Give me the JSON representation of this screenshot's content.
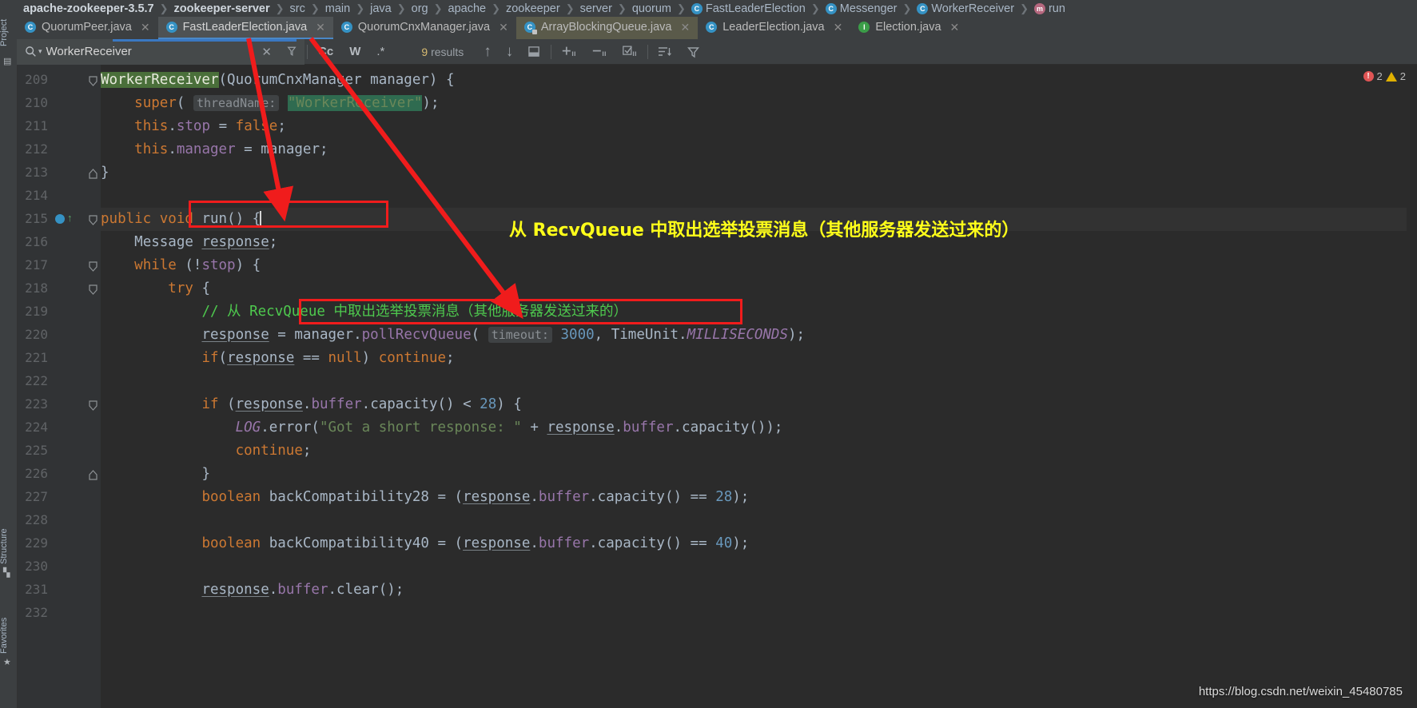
{
  "breadcrumb": [
    {
      "label": "apache-zookeeper-3.5.7",
      "bold": true,
      "squiggle": false,
      "badge": ""
    },
    {
      "label": "zookeeper-server",
      "bold": true,
      "squiggle": false,
      "badge": ""
    },
    {
      "label": "src",
      "bold": false,
      "squiggle": true,
      "badge": ""
    },
    {
      "label": "main",
      "bold": false,
      "squiggle": true,
      "badge": ""
    },
    {
      "label": "java",
      "bold": false,
      "squiggle": true,
      "badge": ""
    },
    {
      "label": "org",
      "bold": false,
      "squiggle": true,
      "badge": ""
    },
    {
      "label": "apache",
      "bold": false,
      "squiggle": true,
      "badge": ""
    },
    {
      "label": "zookeeper",
      "bold": false,
      "squiggle": true,
      "badge": ""
    },
    {
      "label": "server",
      "bold": false,
      "squiggle": true,
      "badge": ""
    },
    {
      "label": "quorum",
      "bold": false,
      "squiggle": false,
      "badge": ""
    },
    {
      "label": "FastLeaderElection",
      "bold": false,
      "squiggle": false,
      "badge": "class"
    },
    {
      "label": "Messenger",
      "bold": false,
      "squiggle": false,
      "badge": "class"
    },
    {
      "label": "WorkerReceiver",
      "bold": false,
      "squiggle": false,
      "badge": "class"
    },
    {
      "label": "run",
      "bold": false,
      "squiggle": false,
      "badge": "method"
    }
  ],
  "tabs": [
    {
      "label": "QuorumPeer.java",
      "badge": "class",
      "active": false,
      "highlight": false,
      "locked": false
    },
    {
      "label": "FastLeaderElection.java",
      "badge": "class",
      "active": true,
      "highlight": false,
      "locked": false
    },
    {
      "label": "QuorumCnxManager.java",
      "badge": "class",
      "active": false,
      "highlight": false,
      "locked": false
    },
    {
      "label": "ArrayBlockingQueue.java",
      "badge": "class",
      "active": false,
      "highlight": true,
      "locked": true
    },
    {
      "label": "LeaderElection.java",
      "badge": "class",
      "active": false,
      "highlight": false,
      "locked": false
    },
    {
      "label": "Election.java",
      "badge": "interface",
      "active": false,
      "highlight": false,
      "locked": false
    }
  ],
  "find": {
    "query": "WorkerReceiver",
    "results_label": "results",
    "results_count": "9",
    "icons": {
      "search": "search-icon",
      "clear": "✕",
      "filter": "⌕",
      "match_case": "Cc",
      "words": "W",
      "regex": ".*",
      "prev": "↑",
      "next": "↓",
      "select_all": "▭",
      "add_line": "+",
      "remove_line": "−",
      "toggle": "☑",
      "sort": "≡",
      "funnel": "▼"
    }
  },
  "sidebar": {
    "project_label": "Project",
    "structure_label": "Structure",
    "favorites_label": "Favorites"
  },
  "inspections": {
    "errors": "2",
    "warnings": "2"
  },
  "watermark": "https://blog.csdn.net/weixin_45480785",
  "annotation": {
    "yellow_note": "从 RecvQueue 中取出选举投票消息（其他服务器发送过来的）"
  },
  "code": {
    "first_line_number": 209,
    "lines": [
      {
        "n": 209,
        "indent": 0,
        "fold": "end",
        "html": "<span class=\"sel-search\">WorkerReceiver</span><span class=\"plain\">(QuorumCnxManager manager) {</span>"
      },
      {
        "n": 210,
        "indent": 0,
        "fold": "",
        "html": "    <span class=\"kw\">super</span><span class=\"plain\">(</span> <span class=\"hint\">threadName:</span> <span class=\"sel-search2 str\">\"WorkerReceiver\"</span><span class=\"plain\">);</span>"
      },
      {
        "n": 211,
        "indent": 0,
        "fold": "",
        "html": "    <span class=\"kw\">this</span><span class=\"plain\">.</span><span class=\"fld\">stop</span> <span class=\"plain\">=</span> <span class=\"kw\">false</span><span class=\"plain\">;</span>"
      },
      {
        "n": 212,
        "indent": 0,
        "fold": "",
        "html": "    <span class=\"kw\">this</span><span class=\"plain\">.</span><span class=\"fld\">manager</span> <span class=\"plain\">= manager;</span>"
      },
      {
        "n": 213,
        "indent": 0,
        "fold": "start",
        "html": "<span class=\"plain\">}</span>"
      },
      {
        "n": 214,
        "indent": 0,
        "fold": "",
        "html": ""
      },
      {
        "n": 215,
        "indent": 0,
        "fold": "end",
        "html": "<span class=\"kw\">public void </span><span class=\"plain\">run() {</span>"
      },
      {
        "n": 216,
        "indent": 0,
        "fold": "",
        "html": "    <span class=\"plain\">Message </span><span class=\"uline plain\">response</span><span class=\"plain\">;</span>"
      },
      {
        "n": 217,
        "indent": 0,
        "fold": "end",
        "html": "    <span class=\"kw\">while</span><span class=\"plain\"> (!</span><span class=\"fld\">stop</span><span class=\"plain\">) {</span>"
      },
      {
        "n": 218,
        "indent": 0,
        "fold": "end",
        "html": "        <span class=\"kw\">try</span><span class=\"plain\"> {</span>"
      },
      {
        "n": 219,
        "indent": 0,
        "fold": "",
        "html": "            <span class=\"cmt\">// 从 RecvQueue 中取出选举投票消息（其他服务器发送过来的）</span>"
      },
      {
        "n": 220,
        "indent": 0,
        "fold": "",
        "html": "            <span class=\"uline plain\">response</span><span class=\"plain\"> = manager.</span><span class=\"fld\">pollRecvQueue</span><span class=\"plain\">(</span> <span class=\"hint\">timeout:</span> <span class=\"num\">3000</span><span class=\"plain\">, TimeUnit.</span><span class=\"stat\">MILLISECONDS</span><span class=\"plain\">);</span>"
      },
      {
        "n": 221,
        "indent": 0,
        "fold": "",
        "html": "            <span class=\"kw\">if</span><span class=\"plain\">(</span><span class=\"uline plain\">response</span><span class=\"plain\"> == </span><span class=\"kw\">null</span><span class=\"plain\">) </span><span class=\"kw\">continue</span><span class=\"plain\">;</span>"
      },
      {
        "n": 222,
        "indent": 0,
        "fold": "",
        "html": ""
      },
      {
        "n": 223,
        "indent": 0,
        "fold": "end",
        "html": "            <span class=\"kw\">if</span><span class=\"plain\"> (</span><span class=\"uline plain\">response</span><span class=\"plain\">.</span><span class=\"fld\">buffer</span><span class=\"plain\">.capacity() &lt; </span><span class=\"num\">28</span><span class=\"plain\">) {</span>"
      },
      {
        "n": 224,
        "indent": 0,
        "fold": "",
        "html": "                <span class=\"logident\">LOG</span><span class=\"plain\">.error(</span><span class=\"str\">\"Got a short response: \"</span><span class=\"plain\"> + </span><span class=\"uline plain\">response</span><span class=\"plain\">.</span><span class=\"fld\">buffer</span><span class=\"plain\">.capacity());</span>"
      },
      {
        "n": 225,
        "indent": 0,
        "fold": "",
        "html": "                <span class=\"kw\">continue</span><span class=\"plain\">;</span>"
      },
      {
        "n": 226,
        "indent": 0,
        "fold": "start",
        "html": "            <span class=\"plain\">}</span>"
      },
      {
        "n": 227,
        "indent": 0,
        "fold": "",
        "html": "            <span class=\"kw\">boolean</span><span class=\"plain\"> backCompatibility28 = (</span><span class=\"uline plain\">response</span><span class=\"plain\">.</span><span class=\"fld\">buffer</span><span class=\"plain\">.capacity() == </span><span class=\"num\">28</span><span class=\"plain\">);</span>"
      },
      {
        "n": 228,
        "indent": 0,
        "fold": "",
        "html": ""
      },
      {
        "n": 229,
        "indent": 0,
        "fold": "",
        "html": "            <span class=\"kw\">boolean</span><span class=\"plain\"> backCompatibility40 = (</span><span class=\"uline plain\">response</span><span class=\"plain\">.</span><span class=\"fld\">buffer</span><span class=\"plain\">.capacity() == </span><span class=\"num\">40</span><span class=\"plain\">);</span>"
      },
      {
        "n": 230,
        "indent": 0,
        "fold": "",
        "html": ""
      },
      {
        "n": 231,
        "indent": 0,
        "fold": "",
        "html": "            <span class=\"uline plain\">response</span><span class=\"plain\">.</span><span class=\"fld\">buffer</span><span class=\"plain\">.clear();</span>"
      },
      {
        "n": 232,
        "indent": 0,
        "fold": "",
        "html": ""
      }
    ]
  }
}
